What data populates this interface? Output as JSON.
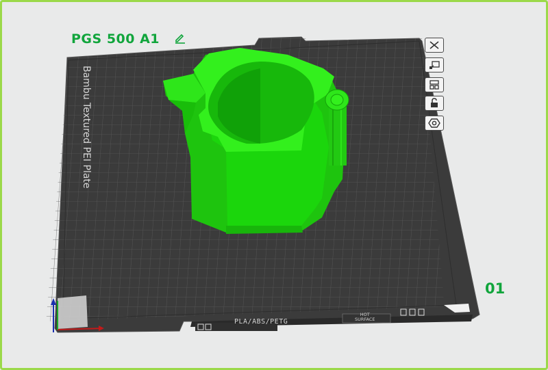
{
  "plate": {
    "title": "PGS 500 A1",
    "number": "01",
    "plate_type_label": "Bambu Textured PEI Plate",
    "filament_label": "PLA/ABS/PETG",
    "hot_surface_line1": "HOT",
    "hot_surface_line2": "SURFACE"
  },
  "toolbar": {
    "items": [
      {
        "name": "close-plate-icon"
      },
      {
        "name": "auto-orient-icon"
      },
      {
        "name": "arrange-icon"
      },
      {
        "name": "lock-icon"
      },
      {
        "name": "plate-settings-icon"
      }
    ]
  },
  "colors": {
    "model": "#1fdd10",
    "model_top": "#33f01d",
    "plate": "#3b3b3b",
    "title": "#11a53c",
    "frame": "#9bd94a"
  }
}
